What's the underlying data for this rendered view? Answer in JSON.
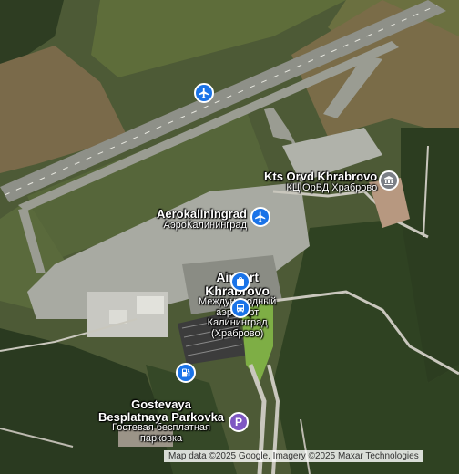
{
  "labels": {
    "kts": {
      "name_en": "Kts Orvd Khrabrovo",
      "name_ru": "КЦ ОрВД Храброво"
    },
    "aerokaliningrad": {
      "name_en": "Aerokaliningrad",
      "name_ru": "АэроКалининград"
    },
    "airport": {
      "name_en_1": "Airport",
      "name_en_2": "Khrabrovo",
      "name_ru_1": "Международный",
      "name_ru_2": "аэропорт",
      "name_ru_3": "Калининград",
      "name_ru_4": "(Храброво)"
    },
    "parking": {
      "name_en_1": "Gostevaya",
      "name_en_2": "Besplatnaya Parkovka",
      "name_ru_1": "Гостевая бесплатная",
      "name_ru_2": "парковка"
    }
  },
  "icons": {
    "airport_pin": "airplane-icon",
    "museum_pin": "museum-icon",
    "bag_pin": "shopping-bag-icon",
    "bus_pin": "bus-icon",
    "fuel_pin": "fuel-icon",
    "parking_pin": "parking-icon",
    "parking_letter": "P"
  },
  "colors": {
    "poi_blue": "#1a73e8",
    "poi_grey": "#7b7f86",
    "parking_purple": "#7e57c2",
    "highlight_green": "#8bc34a"
  },
  "attribution": "Map data ©2025 Google, Imagery ©2025 Maxar Technologies"
}
